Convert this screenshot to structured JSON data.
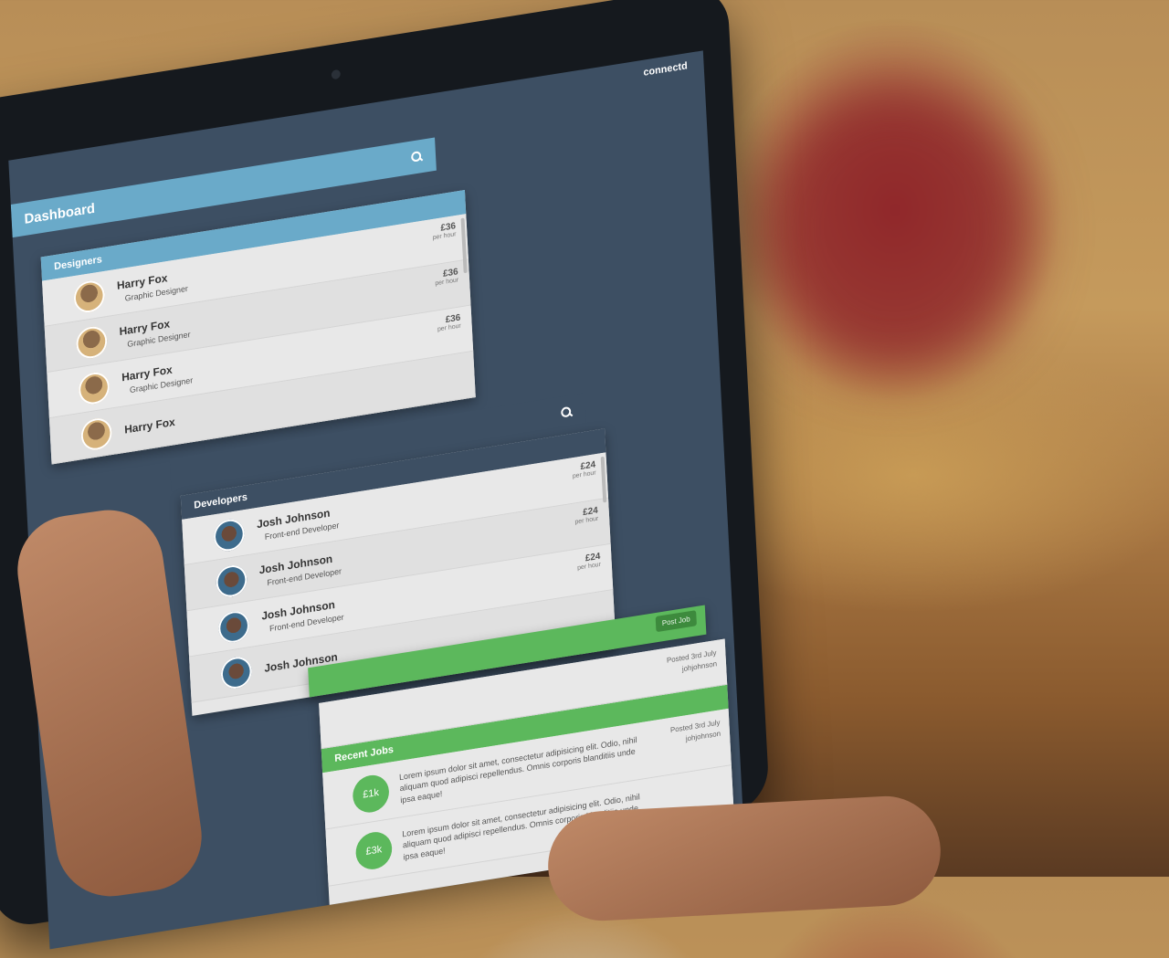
{
  "app": {
    "brand": "connectd",
    "title": "Dashboard"
  },
  "designers": {
    "heading": "Designers",
    "items": [
      {
        "name": "Harry Fox",
        "role": "Graphic Designer",
        "price": "£36",
        "unit": "per hour"
      },
      {
        "name": "Harry Fox",
        "role": "Graphic Designer",
        "price": "£36",
        "unit": "per hour"
      },
      {
        "name": "Harry Fox",
        "role": "Graphic Designer",
        "price": "£36",
        "unit": "per hour"
      },
      {
        "name": "Harry Fox",
        "role": "",
        "price": "",
        "unit": ""
      }
    ]
  },
  "developers": {
    "heading": "Developers",
    "items": [
      {
        "name": "Josh Johnson",
        "role": "Front-end Developer",
        "price": "£24",
        "unit": "per hour"
      },
      {
        "name": "Josh Johnson",
        "role": "Front-end Developer",
        "price": "£24",
        "unit": "per hour"
      },
      {
        "name": "Josh Johnson",
        "role": "Front-end Developer",
        "price": "£24",
        "unit": "per hour"
      },
      {
        "name": "Josh Johnson",
        "role": "",
        "price": "",
        "unit": ""
      }
    ]
  },
  "jobs": {
    "heading": "Recent Jobs",
    "post_button": "Post Job",
    "items": [
      {
        "amount": "",
        "text": "",
        "posted": "Posted 3rd July",
        "user": "johjohnson"
      },
      {
        "amount": "£1k",
        "text": "Lorem ipsum dolor sit amet, consectetur adipisicing elit. Odio, nihil aliquam quod adipisci repellendus. Omnis corporis blanditiis unde ipsa eaque!",
        "posted": "Posted 3rd July",
        "user": "johjohnson"
      },
      {
        "amount": "£3k",
        "text": "Lorem ipsum dolor sit amet, consectetur adipisicing elit. Odio, nihil aliquam quod adipisci repellendus. Omnis corporis blanditiis unde ipsa eaque!",
        "posted": "",
        "user": ""
      }
    ]
  },
  "colors": {
    "accent_blue": "#6aaac9",
    "accent_green": "#5cb85c",
    "frame": "#3d4f63"
  }
}
